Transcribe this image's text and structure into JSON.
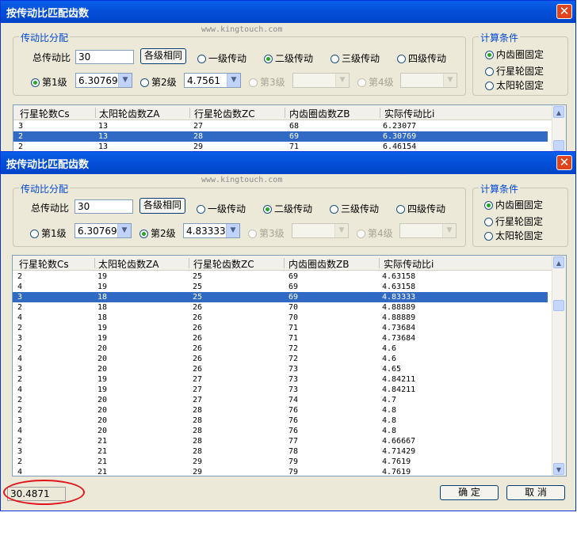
{
  "watermark": "www.kingtouch.com",
  "ratio_group": {
    "title": "传动比分配",
    "total_label": "总传动比",
    "same_button": "各级相同",
    "stage_modes": [
      "一级传动",
      "二级传动",
      "三级传动",
      "四级传动"
    ],
    "stage_labels": [
      "第1级",
      "第2级",
      "第3级",
      "第4级"
    ]
  },
  "condition_group": {
    "title": "计算条件",
    "options": [
      "内齿圈固定",
      "行星轮固定",
      "太阳轮固定"
    ]
  },
  "columns": [
    "行星轮数Cs",
    "太阳轮齿数ZA",
    "行星轮齿数ZC",
    "内齿圈齿数ZB",
    "实际传动比i"
  ],
  "back_window": {
    "title": "按传动比匹配齿数",
    "total_value": "30",
    "stage1_value": "6.30769",
    "stage2_value": "4.7561",
    "rows": [
      [
        "3",
        "13",
        "27",
        "68",
        "6.23077"
      ],
      [
        "2",
        "13",
        "28",
        "69",
        "6.30769"
      ],
      [
        "2",
        "13",
        "29",
        "71",
        "6.46154"
      ]
    ]
  },
  "front_window": {
    "title": "按传动比匹配齿数",
    "total_value": "30",
    "stage1_value": "6.30769",
    "stage2_value": "4.83333",
    "rows": [
      [
        "2",
        "19",
        "25",
        "69",
        "4.63158"
      ],
      [
        "4",
        "19",
        "25",
        "69",
        "4.63158"
      ],
      [
        "3",
        "18",
        "25",
        "69",
        "4.83333"
      ],
      [
        "2",
        "18",
        "26",
        "70",
        "4.88889"
      ],
      [
        "4",
        "18",
        "26",
        "70",
        "4.88889"
      ],
      [
        "2",
        "19",
        "26",
        "71",
        "4.73684"
      ],
      [
        "3",
        "19",
        "26",
        "71",
        "4.73684"
      ],
      [
        "2",
        "20",
        "26",
        "72",
        "4.6"
      ],
      [
        "4",
        "20",
        "26",
        "72",
        "4.6"
      ],
      [
        "3",
        "20",
        "26",
        "73",
        "4.65"
      ],
      [
        "2",
        "19",
        "27",
        "73",
        "4.84211"
      ],
      [
        "4",
        "19",
        "27",
        "73",
        "4.84211"
      ],
      [
        "2",
        "20",
        "27",
        "74",
        "4.7"
      ],
      [
        "2",
        "20",
        "28",
        "76",
        "4.8"
      ],
      [
        "3",
        "20",
        "28",
        "76",
        "4.8"
      ],
      [
        "4",
        "20",
        "28",
        "76",
        "4.8"
      ],
      [
        "2",
        "21",
        "28",
        "77",
        "4.66667"
      ],
      [
        "3",
        "21",
        "28",
        "78",
        "4.71429"
      ],
      [
        "2",
        "21",
        "29",
        "79",
        "4.7619"
      ],
      [
        "4",
        "21",
        "29",
        "79",
        "4.7619"
      ]
    ],
    "ok_button": "确  定",
    "cancel_button": "取  消",
    "status_value": "30.4871"
  },
  "colors": {
    "title_bar": "#0553dc",
    "selection": "#316ac5",
    "highlight_ellipse": "#e0151b",
    "group_title": "#0046d5"
  }
}
